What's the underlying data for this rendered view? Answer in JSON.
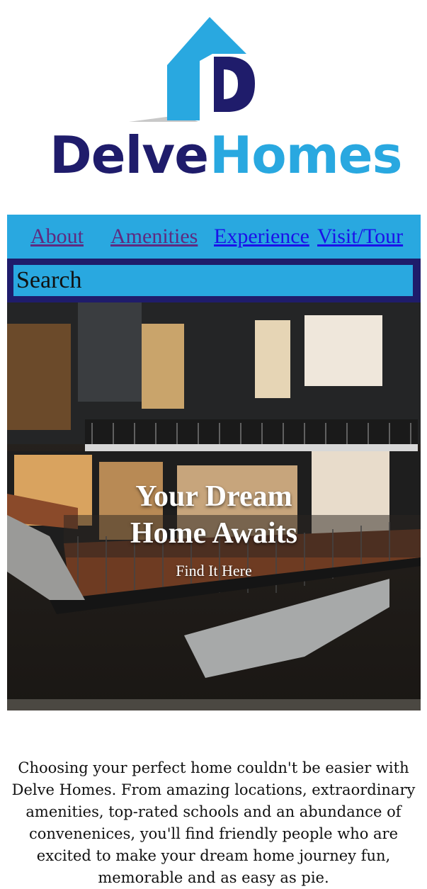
{
  "brand": {
    "name_part1": "Delve",
    "name_part2": "Homes",
    "color_dark": "#1f1c6b",
    "color_light": "#29a8e0"
  },
  "nav": {
    "items": [
      {
        "label": "About",
        "state": "visited"
      },
      {
        "label": "Amenities",
        "state": "visited"
      },
      {
        "label": "Experience",
        "state": "link"
      },
      {
        "label": "Visit/Tour",
        "state": "link"
      }
    ]
  },
  "search": {
    "placeholder": "Search"
  },
  "hero": {
    "title_line1": "Your Dream",
    "title_line2": "Home Awaits",
    "subtitle": "Find It Here",
    "image": "modern-house-photo"
  },
  "intro": {
    "text": "Choosing your perfect home couldn't be easier with Delve Homes. From amazing locations, extraordinary amenities, top-rated schools and an abundance of convenenices, you'll find friendly people who are excited to make your dream home journey fun, memorable and as easy as pie."
  }
}
